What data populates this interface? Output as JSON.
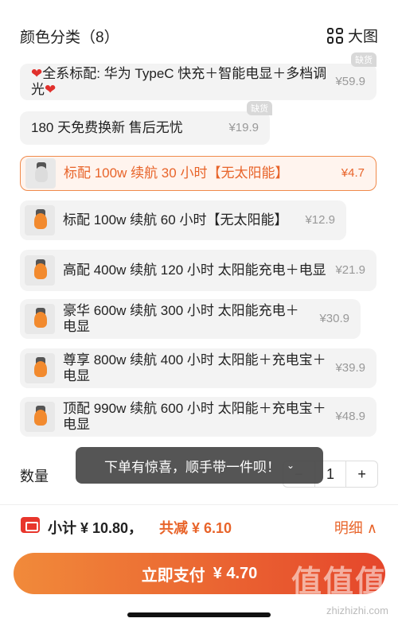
{
  "header": {
    "title": "颜色分类（8）",
    "big_image_label": "大图"
  },
  "options": [
    {
      "label": "全系标配: 华为 TypeC 快充＋智能电显＋多档调光",
      "price": "¥59.9",
      "soldout": "缺货",
      "selected": false
    },
    {
      "label": "180 天免费换新 售后无忧",
      "price": "¥19.9",
      "soldout": "缺货",
      "selected": false
    },
    {
      "label": "标配 100w 续航 30 小时【无太阳能】",
      "price": "¥4.7",
      "selected": true
    },
    {
      "label": "标配 100w 续航 60 小时【无太阳能】",
      "price": "¥12.9",
      "selected": false
    },
    {
      "label": "高配 400w 续航 120 小时 太阳能充电＋电显",
      "price": "¥21.9",
      "selected": false
    },
    {
      "label": "豪华 600w 续航 300 小时 太阳能充电＋电显",
      "price": "¥30.9",
      "selected": false
    },
    {
      "label": "尊享 800w 续航 400 小时 太阳能＋充电宝＋电显",
      "price": "¥39.9",
      "selected": false
    },
    {
      "label": "顶配 990w 续航 600 小时 太阳能＋充电宝＋电显",
      "price": "¥48.9",
      "selected": false
    }
  ],
  "quantity": {
    "label": "数量",
    "minus": "−",
    "value": "1",
    "plus": "+"
  },
  "toast": {
    "text": "下单有惊喜，顺手带一件呗！",
    "chevron": "⌄"
  },
  "summary": {
    "subtotal": "小计 ¥ 10.80，",
    "discount": "共减 ¥ 6.10",
    "detail": "明细 ∧"
  },
  "pay": {
    "label": "立即支付",
    "amount": "¥ 4.70"
  },
  "watermark": {
    "logo": "值值值",
    "url": "zhizhizhi.com"
  },
  "colors": {
    "accent": "#e8642a",
    "selected_bg": "#fff4ee",
    "option_bg": "#f3f3f3"
  }
}
